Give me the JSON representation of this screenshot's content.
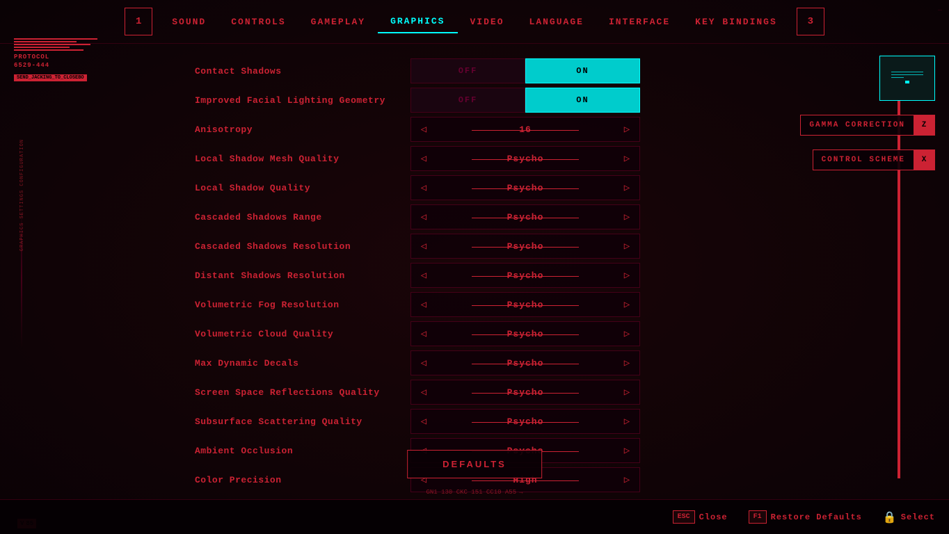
{
  "nav": {
    "num1": "1",
    "num3": "3",
    "items": [
      {
        "label": "SOUND",
        "active": false
      },
      {
        "label": "CONTROLS",
        "active": false
      },
      {
        "label": "GAMEPLAY",
        "active": false
      },
      {
        "label": "GRAPHICS",
        "active": true
      },
      {
        "label": "VIDEO",
        "active": false
      },
      {
        "label": "LANGUAGE",
        "active": false
      },
      {
        "label": "INTERFACE",
        "active": false
      },
      {
        "label": "KEY BINDINGS",
        "active": false
      }
    ]
  },
  "logo": {
    "title": "PROTOCOL",
    "code": "6529-444",
    "badge": "SEND_JACKING_TO_CLOSEBO"
  },
  "settings": [
    {
      "label": "Contact Shadows",
      "type": "toggle",
      "offLabel": "OFF",
      "onLabel": "ON",
      "value": "on"
    },
    {
      "label": "Improved Facial Lighting Geometry",
      "type": "toggle",
      "offLabel": "OFF",
      "onLabel": "ON",
      "value": "on"
    },
    {
      "label": "Anisotropy",
      "type": "arrow",
      "value": "16"
    },
    {
      "label": "Local Shadow Mesh Quality",
      "type": "arrow",
      "value": "Psycho"
    },
    {
      "label": "Local Shadow Quality",
      "type": "arrow",
      "value": "Psycho"
    },
    {
      "label": "Cascaded Shadows Range",
      "type": "arrow",
      "value": "Psycho"
    },
    {
      "label": "Cascaded Shadows Resolution",
      "type": "arrow",
      "value": "Psycho"
    },
    {
      "label": "Distant Shadows Resolution",
      "type": "arrow",
      "value": "Psycho"
    },
    {
      "label": "Volumetric Fog Resolution",
      "type": "arrow",
      "value": "Psycho"
    },
    {
      "label": "Volumetric Cloud Quality",
      "type": "arrow",
      "value": "Psycho"
    },
    {
      "label": "Max Dynamic Decals",
      "type": "arrow",
      "value": "Psycho"
    },
    {
      "label": "Screen Space Reflections Quality",
      "type": "arrow",
      "value": "Psycho"
    },
    {
      "label": "Subsurface Scattering Quality",
      "type": "arrow",
      "value": "Psycho"
    },
    {
      "label": "Ambient Occlusion",
      "type": "arrow",
      "value": "Psycho"
    },
    {
      "label": "Color Precision",
      "type": "arrow",
      "value": "High"
    }
  ],
  "defaults_btn": "DEFAULTS",
  "right_panel": {
    "gamma_label": "GAMMA CORRECTION",
    "gamma_key": "Z",
    "scheme_label": "CONTROL SCHEME",
    "scheme_key": "X"
  },
  "bottom": {
    "close_key": "ESC",
    "close_label": "Close",
    "restore_key": "F1",
    "restore_label": "Restore Defaults",
    "select_label": "Select"
  },
  "version": {
    "v": "V",
    "num": "85"
  },
  "status_line": "GN1 130 CKC 151 CC10 A55",
  "corner": "—"
}
